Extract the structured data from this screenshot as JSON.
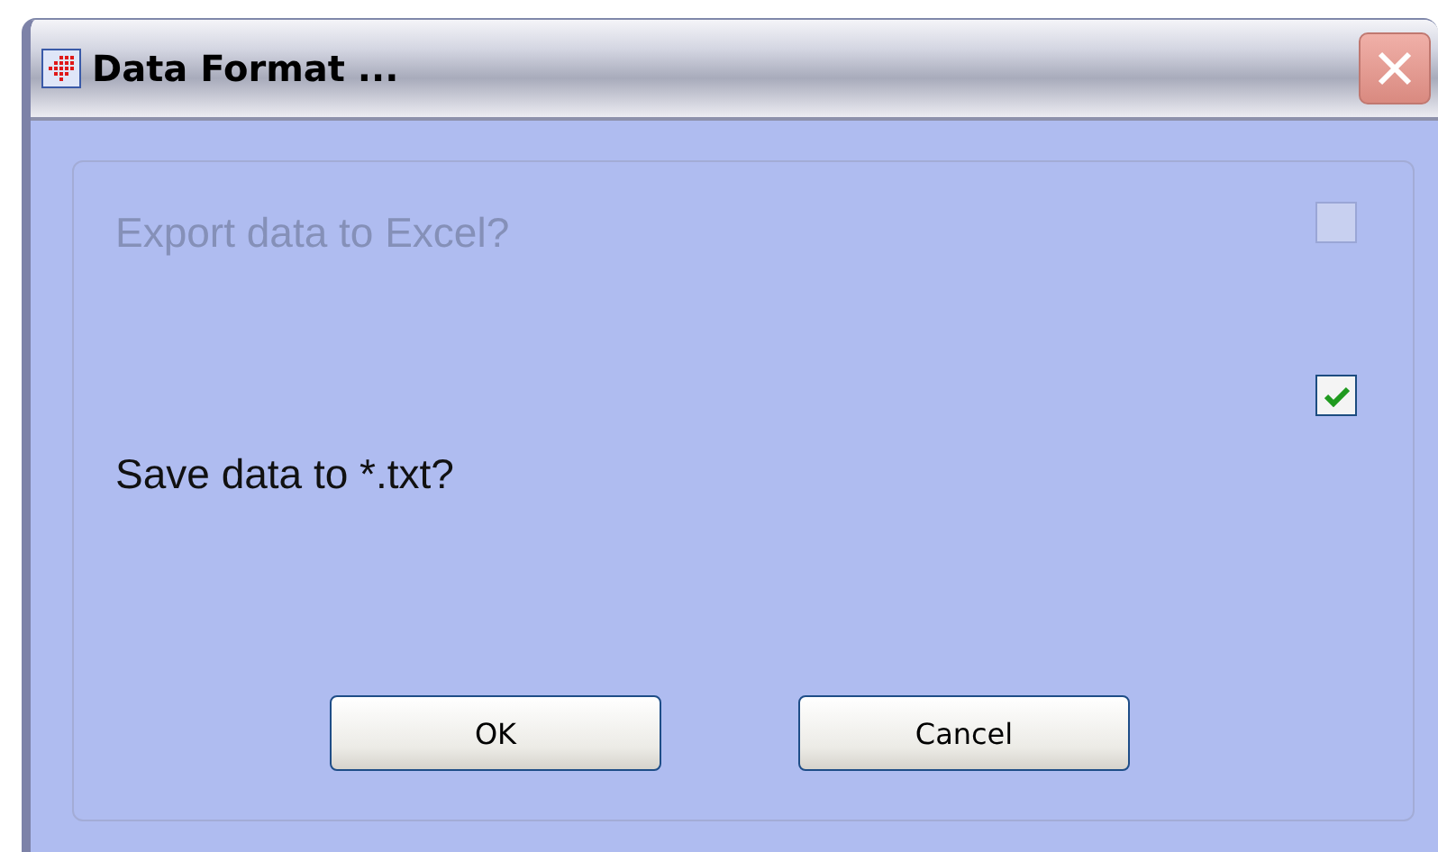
{
  "window": {
    "title": "Data Format ..."
  },
  "options": [
    {
      "label": "Export data to Excel?",
      "checked": false,
      "disabled": true
    },
    {
      "label": "Save data to *.txt?",
      "checked": true,
      "disabled": false
    }
  ],
  "buttons": [
    "OK",
    "Cancel"
  ]
}
